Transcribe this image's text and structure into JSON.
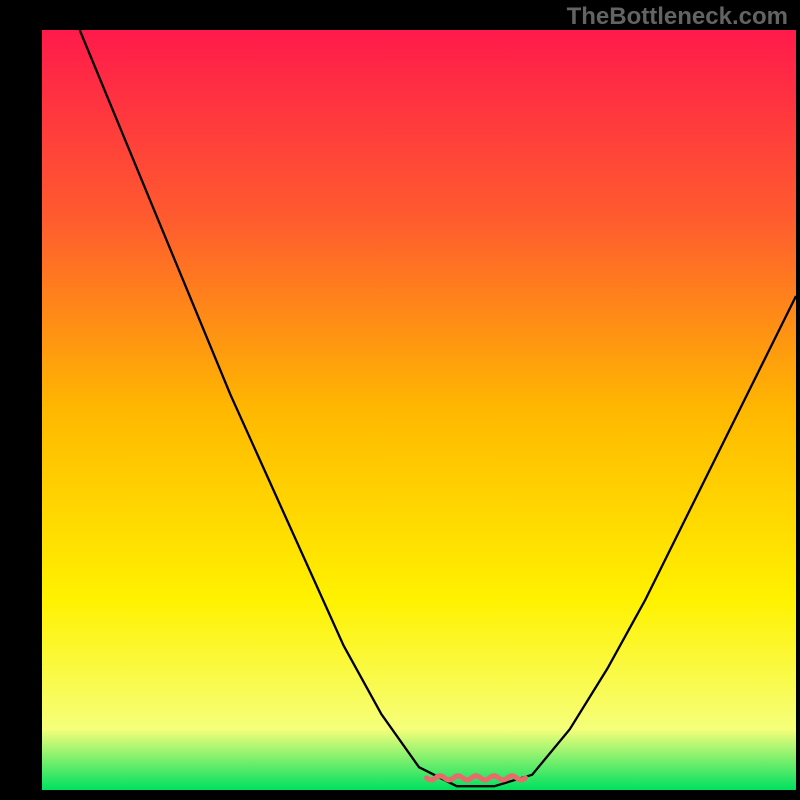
{
  "watermark": "TheBottleneck.com",
  "chart_data": {
    "type": "line",
    "title": "",
    "xlabel": "",
    "ylabel": "",
    "xlim": [
      0,
      100
    ],
    "ylim": [
      0,
      100
    ],
    "grid": false,
    "legend": false,
    "gradient_stops": [
      {
        "offset": 0,
        "color": "#ff1a4b"
      },
      {
        "offset": 25,
        "color": "#ff5c2e"
      },
      {
        "offset": 50,
        "color": "#ffb800"
      },
      {
        "offset": 75,
        "color": "#fff200"
      },
      {
        "offset": 92,
        "color": "#f6ff7a"
      },
      {
        "offset": 100,
        "color": "#00e060"
      }
    ],
    "series": [
      {
        "name": "bottleneck-curve",
        "color": "#000000",
        "points": [
          {
            "x": 5,
            "y": 100
          },
          {
            "x": 10,
            "y": 88
          },
          {
            "x": 15,
            "y": 76
          },
          {
            "x": 20,
            "y": 64
          },
          {
            "x": 25,
            "y": 52
          },
          {
            "x": 30,
            "y": 41
          },
          {
            "x": 35,
            "y": 30
          },
          {
            "x": 40,
            "y": 19
          },
          {
            "x": 45,
            "y": 10
          },
          {
            "x": 50,
            "y": 3
          },
          {
            "x": 55,
            "y": 0.5
          },
          {
            "x": 60,
            "y": 0.5
          },
          {
            "x": 65,
            "y": 2
          },
          {
            "x": 70,
            "y": 8
          },
          {
            "x": 75,
            "y": 16
          },
          {
            "x": 80,
            "y": 25
          },
          {
            "x": 85,
            "y": 35
          },
          {
            "x": 90,
            "y": 45
          },
          {
            "x": 95,
            "y": 55
          },
          {
            "x": 100,
            "y": 65
          }
        ]
      },
      {
        "name": "optimal-band-marker",
        "color": "#e86a6a",
        "style": "squiggle",
        "x_range": [
          51,
          65
        ],
        "y": 1.6
      }
    ]
  }
}
